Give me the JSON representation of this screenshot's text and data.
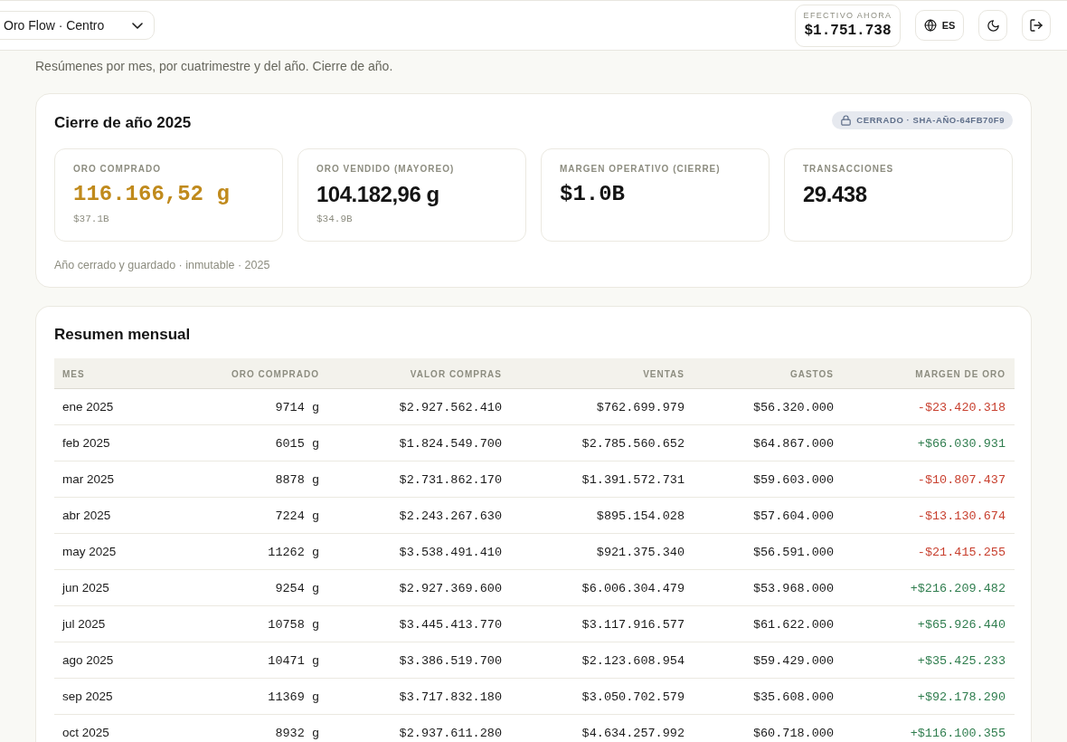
{
  "header": {
    "branch_selector": {
      "value": "Oro Flow · Centro"
    },
    "cash": {
      "label": "EFECTIVO AHORA",
      "value": "$1.751.738"
    },
    "language_button": {
      "label": "ES"
    }
  },
  "subtitle": "Resúmenes por mes, por cuatrimestre y del año. Cierre de año.",
  "year_close": {
    "title": "Cierre de año 2025",
    "badge": "CERRADO · SHA-AÑO-64FB70F9",
    "stats": [
      {
        "label": "ORO COMPRADO",
        "value": "116.166,52 g",
        "sub": "$37.1B",
        "kind": "mono",
        "highlighted": true
      },
      {
        "label": "ORO VENDIDO (MAYOREO)",
        "value": "104.182,96 g",
        "sub": "$34.9B",
        "kind": "sans",
        "highlighted": false
      },
      {
        "label": "MARGEN OPERATIVO (CIERRE)",
        "value": "$1.0B",
        "kind": "mono",
        "highlighted": false
      },
      {
        "label": "TRANSACCIONES",
        "value": "29.438",
        "kind": "sans",
        "highlighted": false
      }
    ],
    "note": "Año cerrado y guardado · inmutable · 2025"
  },
  "monthly": {
    "title": "Resumen mensual",
    "columns": [
      "MES",
      "ORO COMPRADO",
      "VALOR COMPRAS",
      "VENTAS",
      "GASTOS",
      "MARGEN DE ORO"
    ],
    "rows": [
      {
        "month": "ene 2025",
        "gold_bought": "9714 g",
        "purchase_value": "$2.927.562.410",
        "sales": "$762.699.979",
        "expenses": "$56.320.000",
        "margin": "-$23.420.318",
        "positive": false
      },
      {
        "month": "feb 2025",
        "gold_bought": "6015 g",
        "purchase_value": "$1.824.549.700",
        "sales": "$2.785.560.652",
        "expenses": "$64.867.000",
        "margin": "+$66.030.931",
        "positive": true
      },
      {
        "month": "mar 2025",
        "gold_bought": "8878 g",
        "purchase_value": "$2.731.862.170",
        "sales": "$1.391.572.731",
        "expenses": "$59.603.000",
        "margin": "-$10.807.437",
        "positive": false
      },
      {
        "month": "abr 2025",
        "gold_bought": "7224 g",
        "purchase_value": "$2.243.267.630",
        "sales": "$895.154.028",
        "expenses": "$57.604.000",
        "margin": "-$13.130.674",
        "positive": false
      },
      {
        "month": "may 2025",
        "gold_bought": "11262 g",
        "purchase_value": "$3.538.491.410",
        "sales": "$921.375.340",
        "expenses": "$56.591.000",
        "margin": "-$21.415.255",
        "positive": false
      },
      {
        "month": "jun 2025",
        "gold_bought": "9254 g",
        "purchase_value": "$2.927.369.600",
        "sales": "$6.006.304.479",
        "expenses": "$53.968.000",
        "margin": "+$216.209.482",
        "positive": true
      },
      {
        "month": "jul 2025",
        "gold_bought": "10758 g",
        "purchase_value": "$3.445.413.770",
        "sales": "$3.117.916.577",
        "expenses": "$61.622.000",
        "margin": "+$65.926.440",
        "positive": true
      },
      {
        "month": "ago 2025",
        "gold_bought": "10471 g",
        "purchase_value": "$3.386.519.700",
        "sales": "$2.123.608.954",
        "expenses": "$59.429.000",
        "margin": "+$35.425.233",
        "positive": true
      },
      {
        "month": "sep 2025",
        "gold_bought": "11369 g",
        "purchase_value": "$3.717.832.180",
        "sales": "$3.050.702.579",
        "expenses": "$35.608.000",
        "margin": "+$92.178.290",
        "positive": true
      },
      {
        "month": "oct 2025",
        "gold_bought": "8932 g",
        "purchase_value": "$2.937.611.280",
        "sales": "$4.634.257.992",
        "expenses": "$60.718.000",
        "margin": "+$116.100.355",
        "positive": true
      }
    ]
  }
}
